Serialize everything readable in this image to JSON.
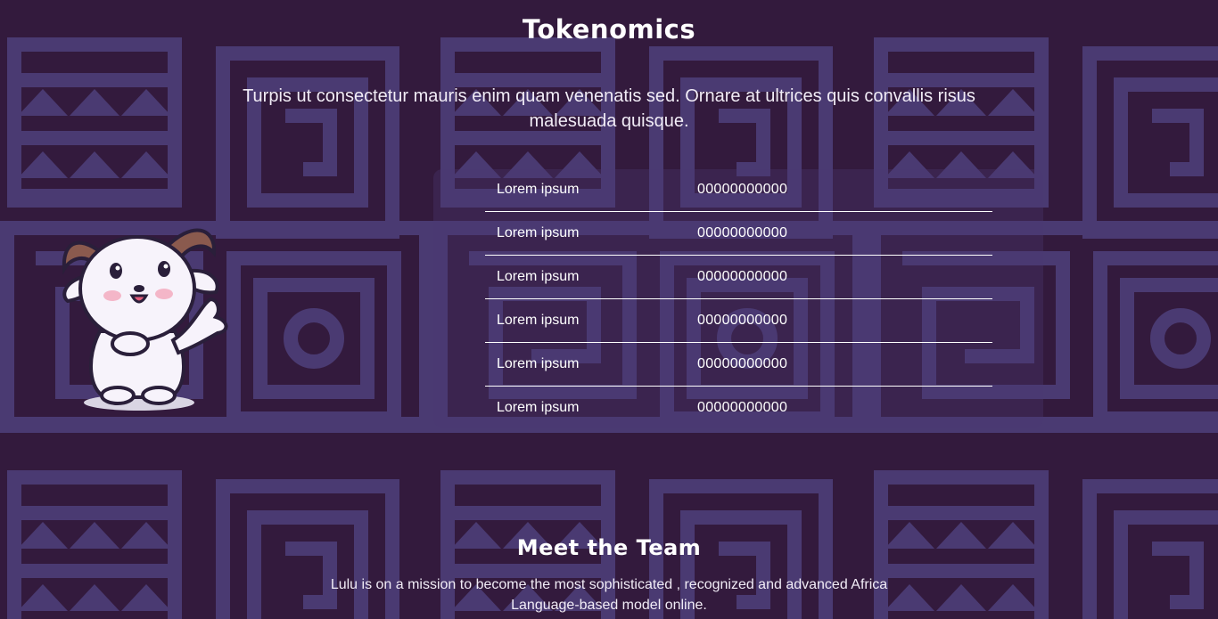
{
  "colors": {
    "background": "#331a3d",
    "pattern": "#4a3a72",
    "text": "#ffffff"
  },
  "tokenomics": {
    "title": "Tokenomics",
    "description": "Turpis ut consectetur mauris enim quam venenatis sed. Ornare at ultrices quis convallis risus malesuada quisque.",
    "rows": [
      {
        "label": "Lorem ipsum",
        "value": "00000000000"
      },
      {
        "label": "Lorem ipsum",
        "value": "00000000000"
      },
      {
        "label": "Lorem ipsum",
        "value": "00000000000"
      },
      {
        "label": "Lorem ipsum",
        "value": "00000000000"
      },
      {
        "label": "Lorem ipsum",
        "value": "00000000000"
      },
      {
        "label": "Lorem ipsum",
        "value": "00000000000"
      }
    ]
  },
  "team": {
    "title": "Meet the Team",
    "description": "Lulu is on a mission to become the most sophisticated , recognized and advanced Africa Language-based model online."
  },
  "mascot": {
    "icon": "goat-mascot-icon"
  }
}
